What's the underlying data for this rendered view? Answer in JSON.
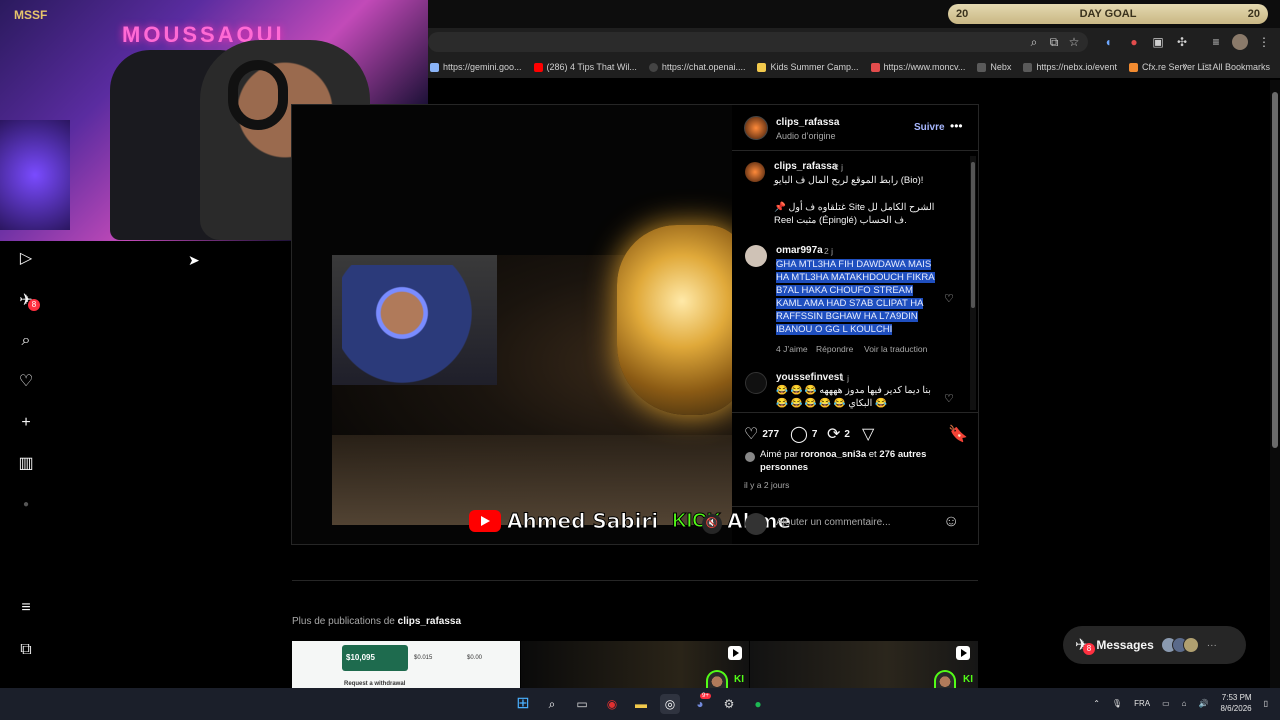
{
  "overlay": {
    "day_goal": {
      "left_count": "20",
      "label": "DAY GOAL",
      "right_count": "20"
    },
    "webcam": {
      "neon_sign": "MOUSSAOUI",
      "logo_text": "MSSF"
    }
  },
  "browser": {
    "bookmarks": [
      {
        "label": "https://gemini.goo...",
        "color": "#8ab4f8"
      },
      {
        "label": "(286) 4 Tips That Wil...",
        "color": "#ff0000"
      },
      {
        "label": "https://chat.openai....",
        "color": "#444444"
      },
      {
        "label": "Kids Summer Camp...",
        "color": "#f2c94c"
      },
      {
        "label": "https://www.moncv...",
        "color": "#e34c4c"
      },
      {
        "label": "Nebx",
        "color": "#5a5a5a"
      },
      {
        "label": "https://nebx.io/event",
        "color": "#5a5a5a"
      },
      {
        "label": "Cfx.re Server List",
        "color": "#f28b30"
      }
    ],
    "all_bookmarks": "All Bookmarks"
  },
  "sidebar": {
    "notification_badge": "8"
  },
  "post": {
    "author": "clips_rafassa",
    "audio": "Audio d’origine",
    "follow": "Suivre",
    "media_caption": {
      "channel": "Ahmed Sabiri",
      "kick": "KICK",
      "trailing": "Ahme"
    },
    "caption": {
      "author": "clips_rafassa",
      "time": "2 j",
      "line1": "رابط الموقع لربح المال ف البايو (Bio)!",
      "line2": "📌 غتلقاوه ف أول Site الشرح الكامل لل",
      "line3": "Reel مثبت (Épinglé) ف الحساب."
    },
    "comments": [
      {
        "author": "omar997a",
        "time": "2 j",
        "text": "GHA MTL3HA FIH DAWDAWA MAIS HA MTL3HA MATAKHDOUCH FIKRA B7AL HAKA CHOUFO STREAM KAML AMA HAD S7AB CLIPAT HA RAFFSSIN BGHAW HA L7A9DIN IBANOU O GG L KOULCHI",
        "likes": "4 J’aime",
        "reply": "Répondre",
        "translate": "Voir la traduction"
      },
      {
        "author": "youssefinvest",
        "time": "1 j",
        "text": "😂 😂 😂 بنا ديما كدير فيها مدوز ههههه",
        "text2": "😂 😂 😂 😂 😂 البكاي 😂"
      }
    ],
    "stats": {
      "likes": "277",
      "comments": "7",
      "reposts": "2"
    },
    "liked_by": {
      "prefix": "Aimé par",
      "user": "roronoa_sni3a",
      "mid": "et",
      "others": "276 autres personnes"
    },
    "age": "il y a 2 jours",
    "add_comment_placeholder": "Ajouter un commentaire..."
  },
  "more": {
    "label_prefix": "Plus de publications de",
    "label_user": "clips_rafassa",
    "thumb1": {
      "v1": "$10,095",
      "v2": "$0.015",
      "v3": "$0.00",
      "note": "Request a withdrawal"
    }
  },
  "messages": {
    "label": "Messages",
    "badge": "8",
    "more": "···"
  },
  "taskbar": {
    "lang": "FRA",
    "time": "7:53 PM",
    "date": "8/6/2026",
    "discord_badge": "9+"
  }
}
